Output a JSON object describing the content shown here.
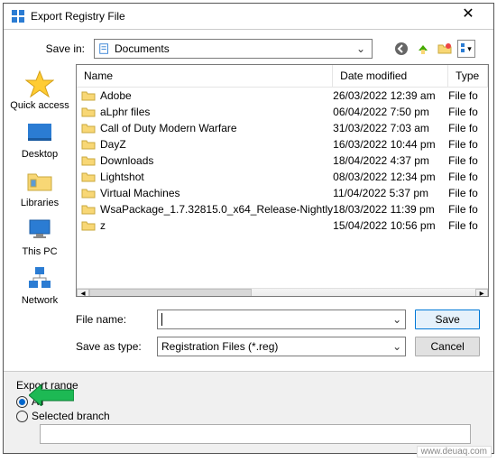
{
  "window": {
    "title": "Export Registry File"
  },
  "toolbar": {
    "save_in_label": "Save in:",
    "save_in_value": "Documents"
  },
  "columns": {
    "name": "Name",
    "date": "Date modified",
    "type": "Type"
  },
  "files": [
    {
      "name": "Adobe",
      "date": "26/03/2022 12:39 am",
      "type": "File fo"
    },
    {
      "name": "aLphr files",
      "date": "06/04/2022 7:50 pm",
      "type": "File fo"
    },
    {
      "name": "Call of Duty Modern Warfare",
      "date": "31/03/2022 7:03 am",
      "type": "File fo"
    },
    {
      "name": "DayZ",
      "date": "16/03/2022 10:44 pm",
      "type": "File fo"
    },
    {
      "name": "Downloads",
      "date": "18/04/2022 4:37 pm",
      "type": "File fo"
    },
    {
      "name": "Lightshot",
      "date": "08/03/2022 12:34 pm",
      "type": "File fo"
    },
    {
      "name": "Virtual Machines",
      "date": "11/04/2022 5:37 pm",
      "type": "File fo"
    },
    {
      "name": "WsaPackage_1.7.32815.0_x64_Release-Nightly",
      "date": "18/03/2022 11:39 pm",
      "type": "File fo"
    },
    {
      "name": "z",
      "date": "15/04/2022 10:56 pm",
      "type": "File fo"
    }
  ],
  "places": {
    "quick": "Quick access",
    "desktop": "Desktop",
    "libraries": "Libraries",
    "thispc": "This PC",
    "network": "Network"
  },
  "form": {
    "filename_label": "File name:",
    "filename_value": "",
    "savetype_label": "Save as type:",
    "savetype_value": "Registration Files (*.reg)",
    "save_btn": "Save",
    "cancel_btn": "Cancel"
  },
  "export": {
    "title": "Export range",
    "all": "All",
    "selected": "Selected branch",
    "branch_value": ""
  },
  "watermark": "www.deuaq.com"
}
